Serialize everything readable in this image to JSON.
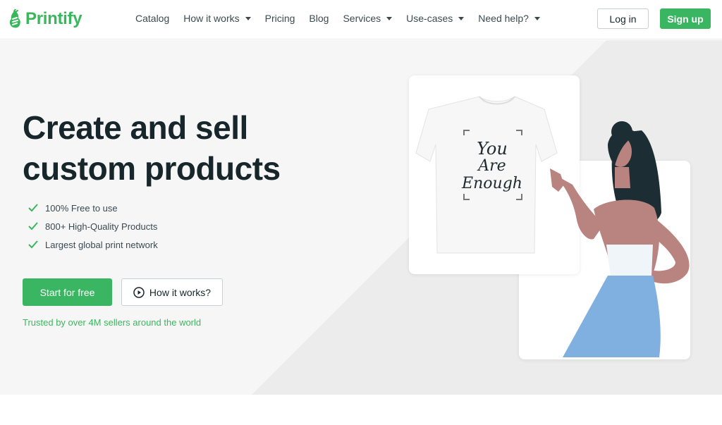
{
  "header": {
    "logo_text": "Printify",
    "nav": [
      {
        "label": "Catalog",
        "dropdown": false
      },
      {
        "label": "How it works",
        "dropdown": true
      },
      {
        "label": "Pricing",
        "dropdown": false
      },
      {
        "label": "Blog",
        "dropdown": false
      },
      {
        "label": "Services",
        "dropdown": true
      },
      {
        "label": "Use-cases",
        "dropdown": true
      },
      {
        "label": "Need help?",
        "dropdown": true
      }
    ],
    "login_label": "Log in",
    "signup_label": "Sign up"
  },
  "hero": {
    "headline_line1": "Create and sell",
    "headline_line2": "custom products",
    "features": [
      "100% Free to use",
      "800+ High-Quality Products",
      "Largest global print network"
    ],
    "start_label": "Start for free",
    "how_label": "How it works?",
    "trusted_text": "Trusted by over 4M sellers around the world"
  },
  "illustration": {
    "shirt_text": [
      "You",
      "Are",
      "Enough"
    ]
  },
  "colors": {
    "brand_green": "#3ab561",
    "text_dark": "#17262b",
    "skirt_blue": "#7fb0e0",
    "skin": "#b9837f",
    "hair": "#1c2d33"
  }
}
